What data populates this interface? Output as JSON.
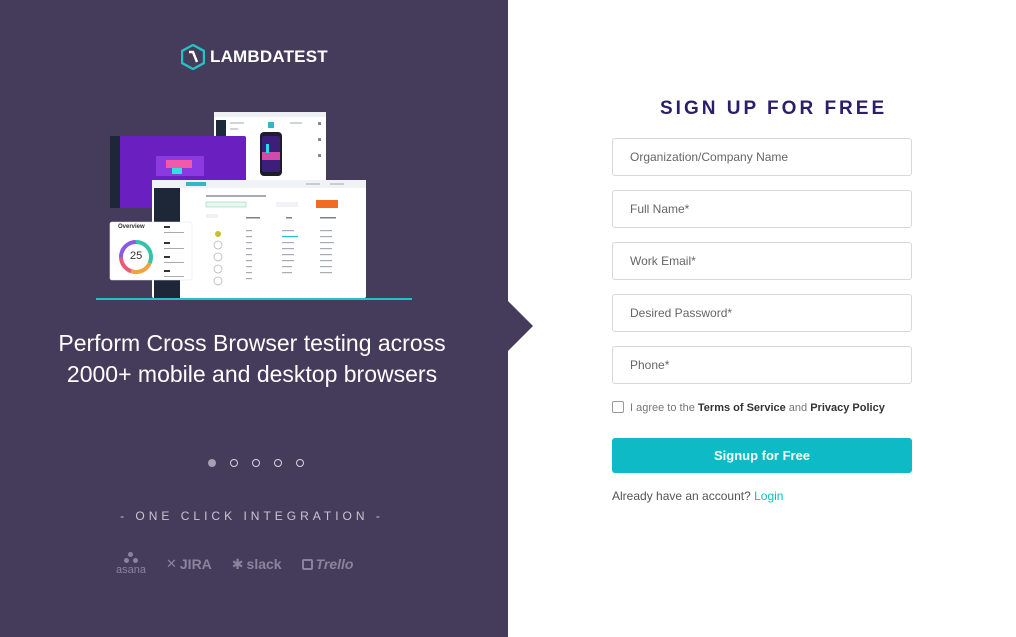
{
  "brand": {
    "name": "LAMBDATEST",
    "accent": "#26c0c5"
  },
  "left": {
    "headline": "Perform Cross Browser testing across 2000+ mobile and desktop browsers",
    "carousel": {
      "count": 5,
      "active": 1
    },
    "integration_title": "- ONE CLICK INTEGRATION -",
    "integrations": [
      "asana",
      "JIRA",
      "slack",
      "Trello"
    ],
    "background": "#453c5c",
    "preview": {
      "overview_label": "Overview",
      "overview_value": "25"
    }
  },
  "form": {
    "title": "SIGN UP FOR FREE",
    "fields": [
      {
        "name": "org",
        "placeholder": "Organization/Company Name"
      },
      {
        "name": "fullname",
        "placeholder": "Full Name*"
      },
      {
        "name": "email",
        "placeholder": "Work Email*"
      },
      {
        "name": "password",
        "placeholder": "Desired Password*"
      },
      {
        "name": "phone",
        "placeholder": "Phone*"
      }
    ],
    "agree_prefix": "I agree to the",
    "terms": "Terms of Service",
    "and": "and",
    "privacy": "Privacy Policy",
    "agree_checked": false,
    "submit": "Signup for Free",
    "login_prompt": "Already have an account?",
    "login_link": "Login",
    "title_color": "#2a1f6b",
    "button_color": "#0ebac5"
  }
}
